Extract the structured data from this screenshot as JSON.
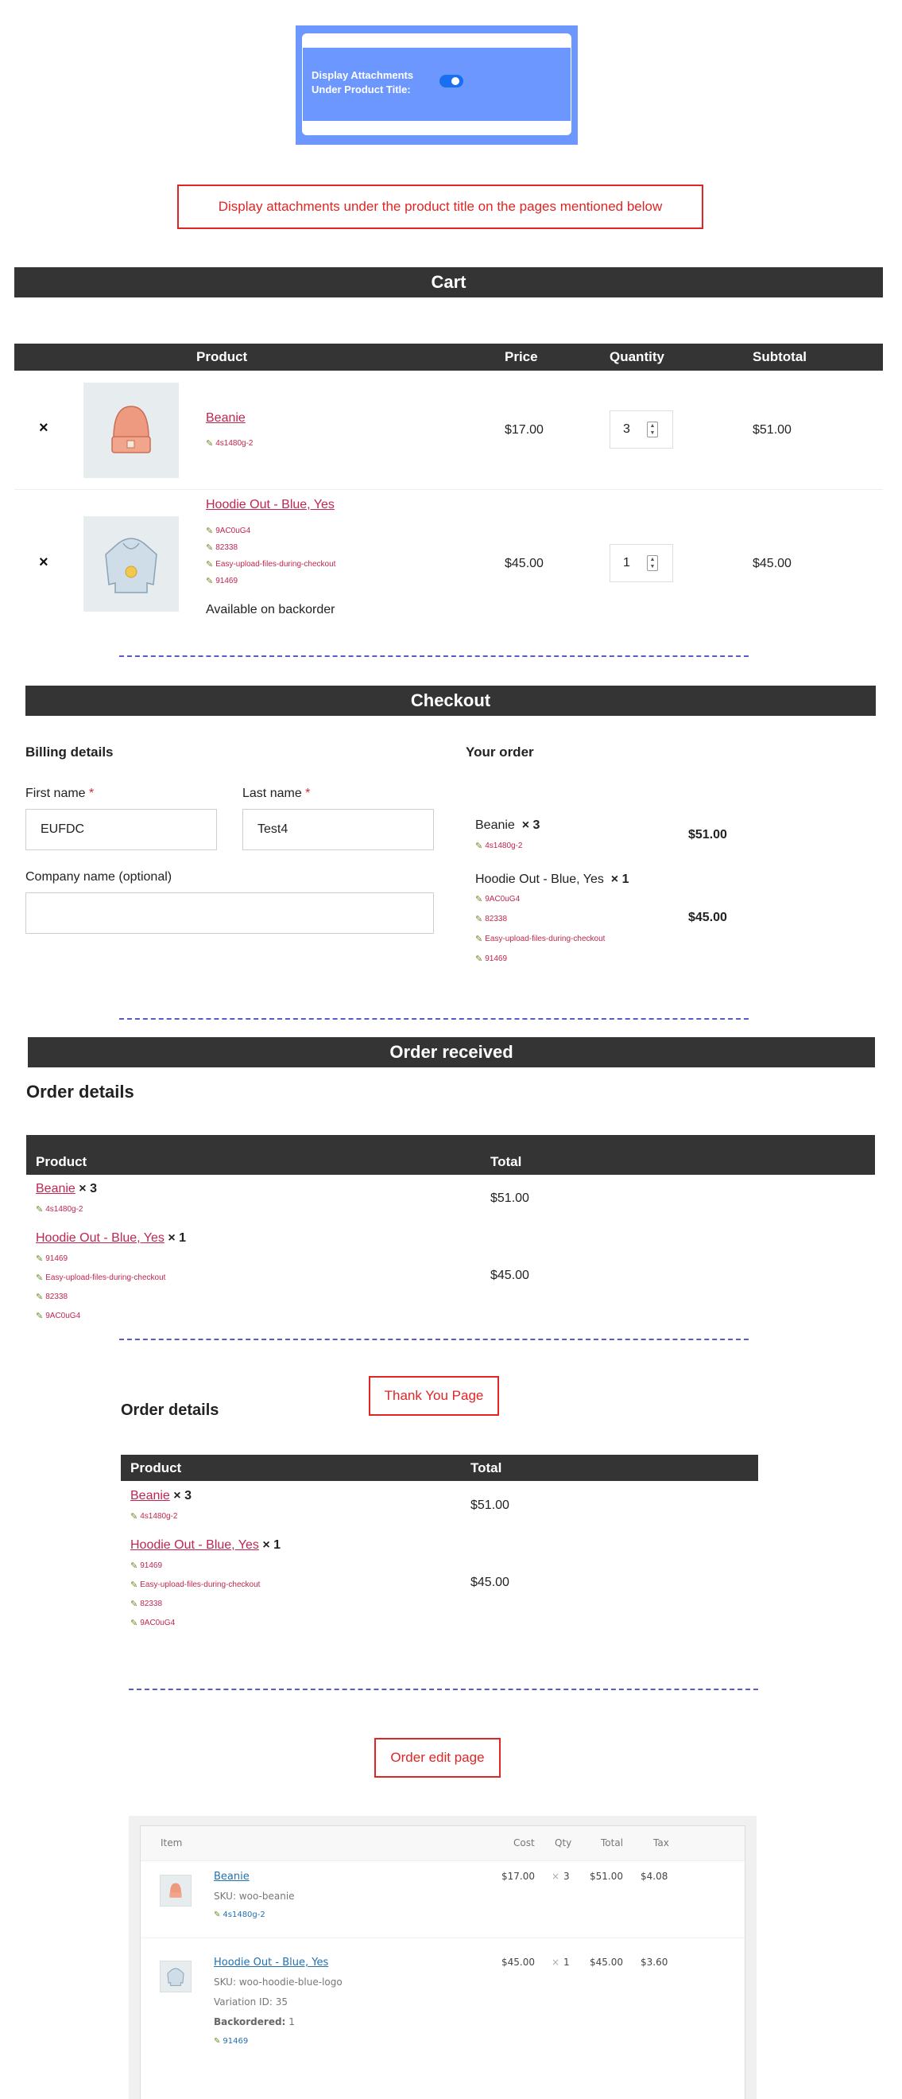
{
  "settings": {
    "toggle_label_line1": "Display Attachments",
    "toggle_label_line2": "Under Product Title:",
    "toggle_state": "on"
  },
  "notice": "Display attachments under the product title on the pages mentioned below",
  "cart": {
    "banner": "Cart",
    "headers": {
      "product": "Product",
      "price": "Price",
      "quantity": "Quantity",
      "subtotal": "Subtotal"
    },
    "items": [
      {
        "name": "Beanie",
        "attachments": [
          "4s1480g-2"
        ],
        "price": "$17.00",
        "qty": "3",
        "subtotal": "$51.00"
      },
      {
        "name": "Hoodie Out - Blue, Yes",
        "attachments": [
          "9AC0uG4",
          "82338",
          "Easy-upload-files-during-checkout",
          "91469"
        ],
        "note": "Available on backorder",
        "price": "$45.00",
        "qty": "1",
        "subtotal": "$45.00"
      }
    ]
  },
  "checkout": {
    "banner": "Checkout",
    "billing_title": "Billing details",
    "first_name_label": "First name",
    "last_name_label": "Last name",
    "required_mark": "*",
    "first_name_value": "EUFDC",
    "last_name_value": "Test4",
    "company_label": "Company name (optional)",
    "company_value": "",
    "order_title": "Your order",
    "items": [
      {
        "name": "Beanie",
        "qty": "× 3",
        "attachments": [
          "4s1480g-2"
        ],
        "total": "$51.00"
      },
      {
        "name": "Hoodie Out - Blue, Yes",
        "qty": "× 1",
        "attachments": [
          "9AC0uG4",
          "82338",
          "Easy-upload-files-during-checkout",
          "91469"
        ],
        "total": "$45.00"
      }
    ]
  },
  "order_received": {
    "banner": "Order received",
    "title": "Order details",
    "headers": {
      "product": "Product",
      "total": "Total"
    },
    "items": [
      {
        "name": "Beanie",
        "qty": "× 3",
        "attachments": [
          "4s1480g-2"
        ],
        "total": "$51.00"
      },
      {
        "name": "Hoodie Out - Blue, Yes",
        "qty": "× 1",
        "attachments": [
          "91469",
          "Easy-upload-files-during-checkout",
          "82338",
          "9AC0uG4"
        ],
        "total": "$45.00"
      }
    ]
  },
  "thank_you": {
    "label": "Thank You Page",
    "title": "Order details",
    "headers": {
      "product": "Product",
      "total": "Total"
    },
    "items": [
      {
        "name": "Beanie",
        "qty": "× 3",
        "attachments": [
          "4s1480g-2"
        ],
        "total": "$51.00"
      },
      {
        "name": "Hoodie Out - Blue, Yes",
        "qty": "× 1",
        "attachments": [
          "91469",
          "Easy-upload-files-during-checkout",
          "82338",
          "9AC0uG4"
        ],
        "total": "$45.00"
      }
    ]
  },
  "order_edit": {
    "label": "Order edit page",
    "headers": {
      "item": "Item",
      "cost": "Cost",
      "qty": "Qty",
      "total": "Total",
      "tax": "Tax"
    },
    "items": [
      {
        "name": "Beanie",
        "sku": "SKU: woo-beanie",
        "attachments": [
          "4s1480g-2"
        ],
        "cost": "$17.00",
        "qty_mark": "×",
        "qty": "3",
        "total": "$51.00",
        "tax": "$4.08"
      },
      {
        "name": "Hoodie Out - Blue, Yes",
        "sku": "SKU: woo-hoodie-blue-logo",
        "variation": "Variation ID: 35",
        "backordered_label": "Backordered:",
        "backordered_value": "1",
        "attachments": [
          "91469"
        ],
        "cost": "$45.00",
        "qty_mark": "×",
        "qty": "1",
        "total": "$45.00",
        "tax": "$3.60"
      }
    ]
  },
  "colors": {
    "accent_blue": "#6b97ff",
    "banner_dark": "#343434",
    "link_red": "#c0264f",
    "notice_red": "#e02525",
    "wp_blue": "#2271b1"
  }
}
